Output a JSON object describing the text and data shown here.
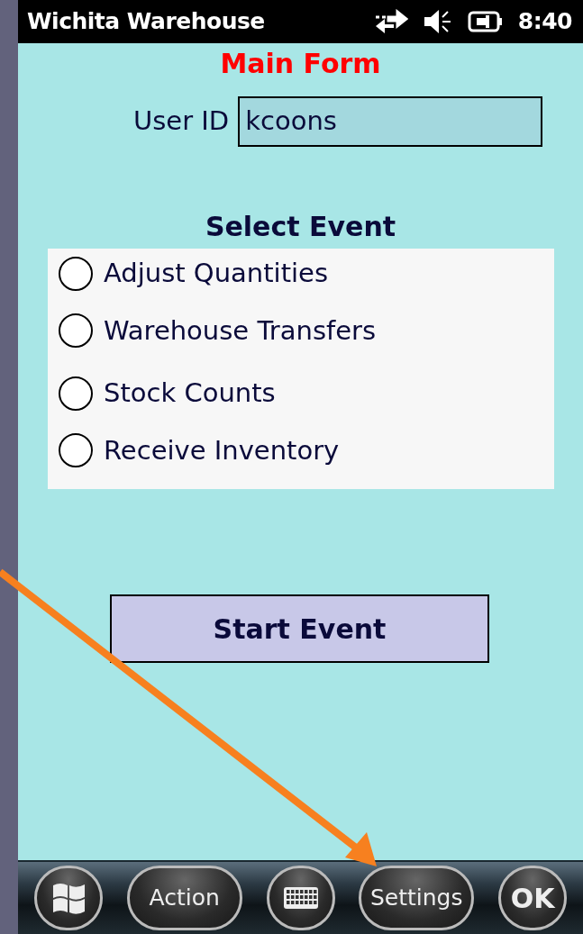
{
  "status_bar": {
    "title": "Wichita Warehouse",
    "time": "8:40"
  },
  "form": {
    "title": "Main Form",
    "user_id": {
      "label": "User ID",
      "value": "kcoons"
    },
    "section_title": "Select Event",
    "events": [
      {
        "label": "Adjust Quantities",
        "selected": false
      },
      {
        "label": "Warehouse Transfers",
        "selected": false
      },
      {
        "label": "Stock Counts",
        "selected": false
      },
      {
        "label": "Receive Inventory",
        "selected": false
      }
    ],
    "start_button": "Start Event"
  },
  "softkeys": [
    {
      "kind": "windows"
    },
    {
      "kind": "text",
      "label": "Action"
    },
    {
      "kind": "keyboard"
    },
    {
      "kind": "text",
      "label": "Settings"
    },
    {
      "kind": "ok",
      "label": "OK"
    }
  ]
}
